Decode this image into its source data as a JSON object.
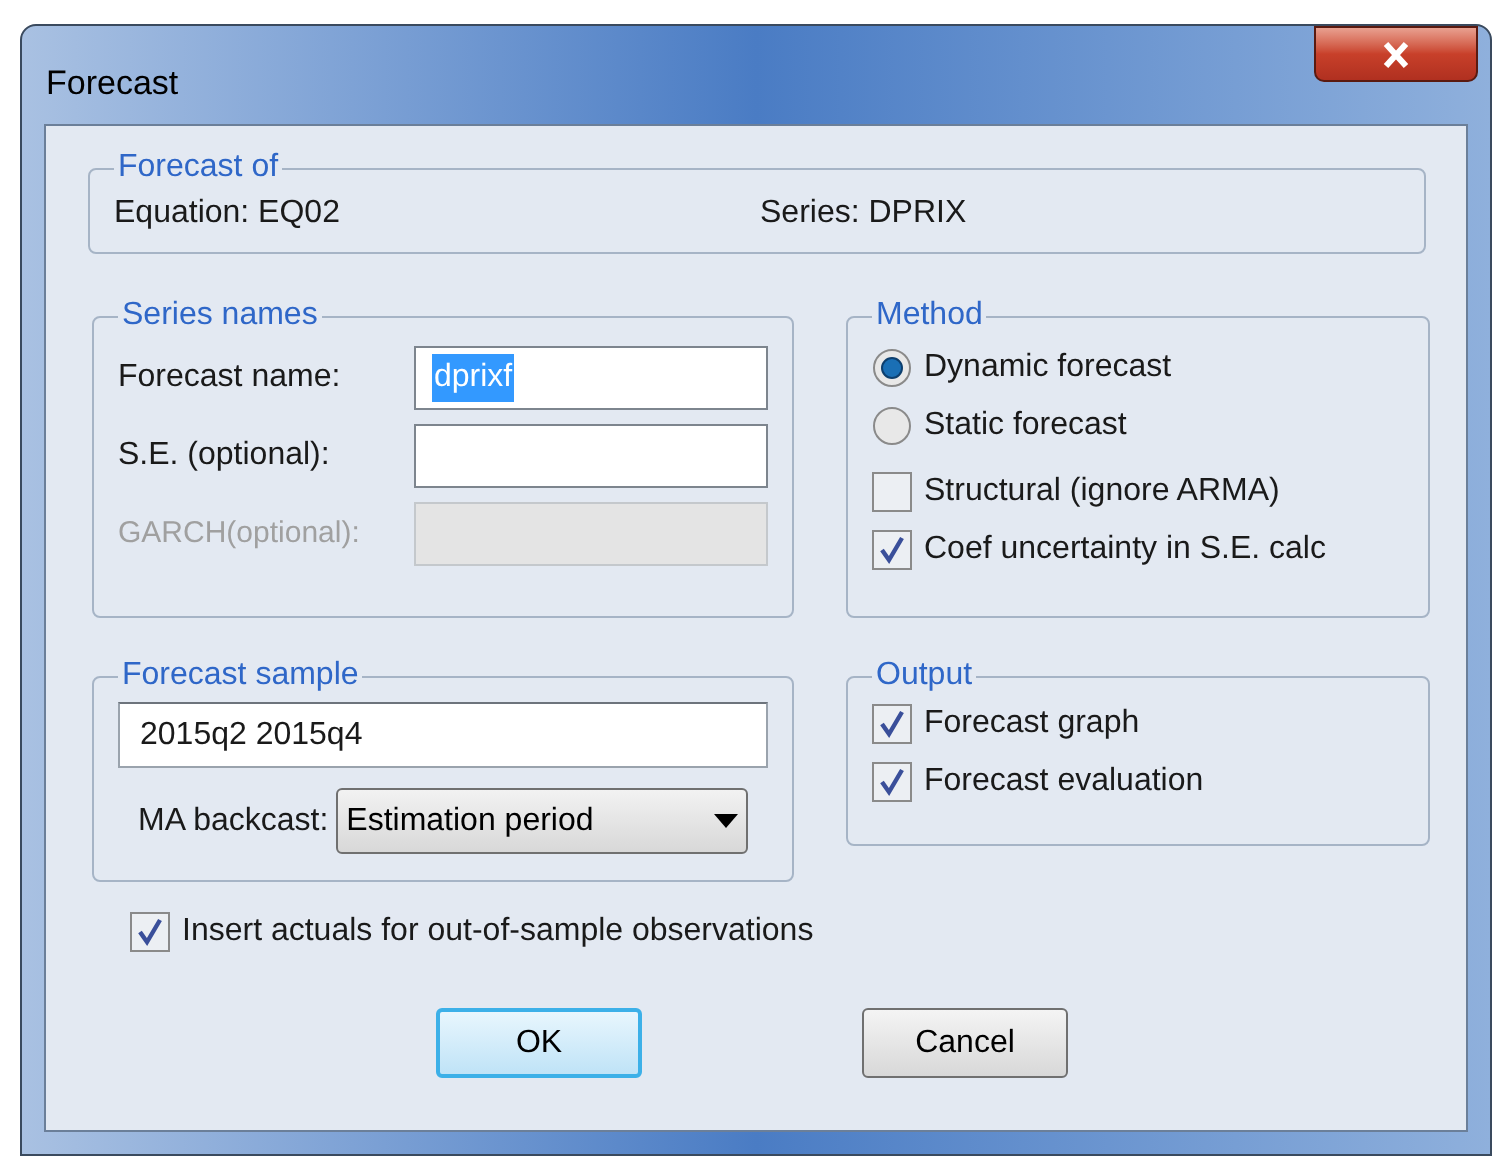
{
  "window": {
    "title": "Forecast"
  },
  "forecast_of": {
    "title": "Forecast of",
    "equation": "Equation: EQ02",
    "series": "Series: DPRIX"
  },
  "series_names": {
    "title": "Series names",
    "fields": [
      {
        "label": "Forecast name:",
        "value": "dprixf",
        "highlighted": true,
        "disabled": false
      },
      {
        "label": "S.E. (optional):",
        "disabled": false
      },
      {
        "label": "GARCH(optional):",
        "disabled": true
      }
    ]
  },
  "method": {
    "title": "Method",
    "options": [
      {
        "kind": "radio",
        "label": "Dynamic forecast",
        "selected": true
      },
      {
        "kind": "radio",
        "label": "Static forecast",
        "selected": false
      },
      {
        "kind": "checkbox",
        "label": "Structural (ignore ARMA)",
        "checked": false
      },
      {
        "kind": "checkbox",
        "label": "Coef uncertainty in S.E. calc",
        "checked": true
      }
    ]
  },
  "forecast_sample": {
    "title": "Forecast sample",
    "value": "2015q2 2015q4",
    "ma_backcast": {
      "label": "MA backcast:",
      "value": "Estimation period"
    }
  },
  "output": {
    "title": "Output",
    "options": [
      {
        "kind": "checkbox",
        "label": "Forecast graph",
        "checked": true
      },
      {
        "kind": "checkbox",
        "label": "Forecast evaluation",
        "checked": true
      }
    ]
  },
  "insert_actuals": {
    "label": "Insert actuals for out-of-sample observations",
    "checked": true
  },
  "buttons": [
    {
      "label": "OK",
      "default": true
    },
    {
      "label": "Cancel",
      "default": false
    }
  ]
}
